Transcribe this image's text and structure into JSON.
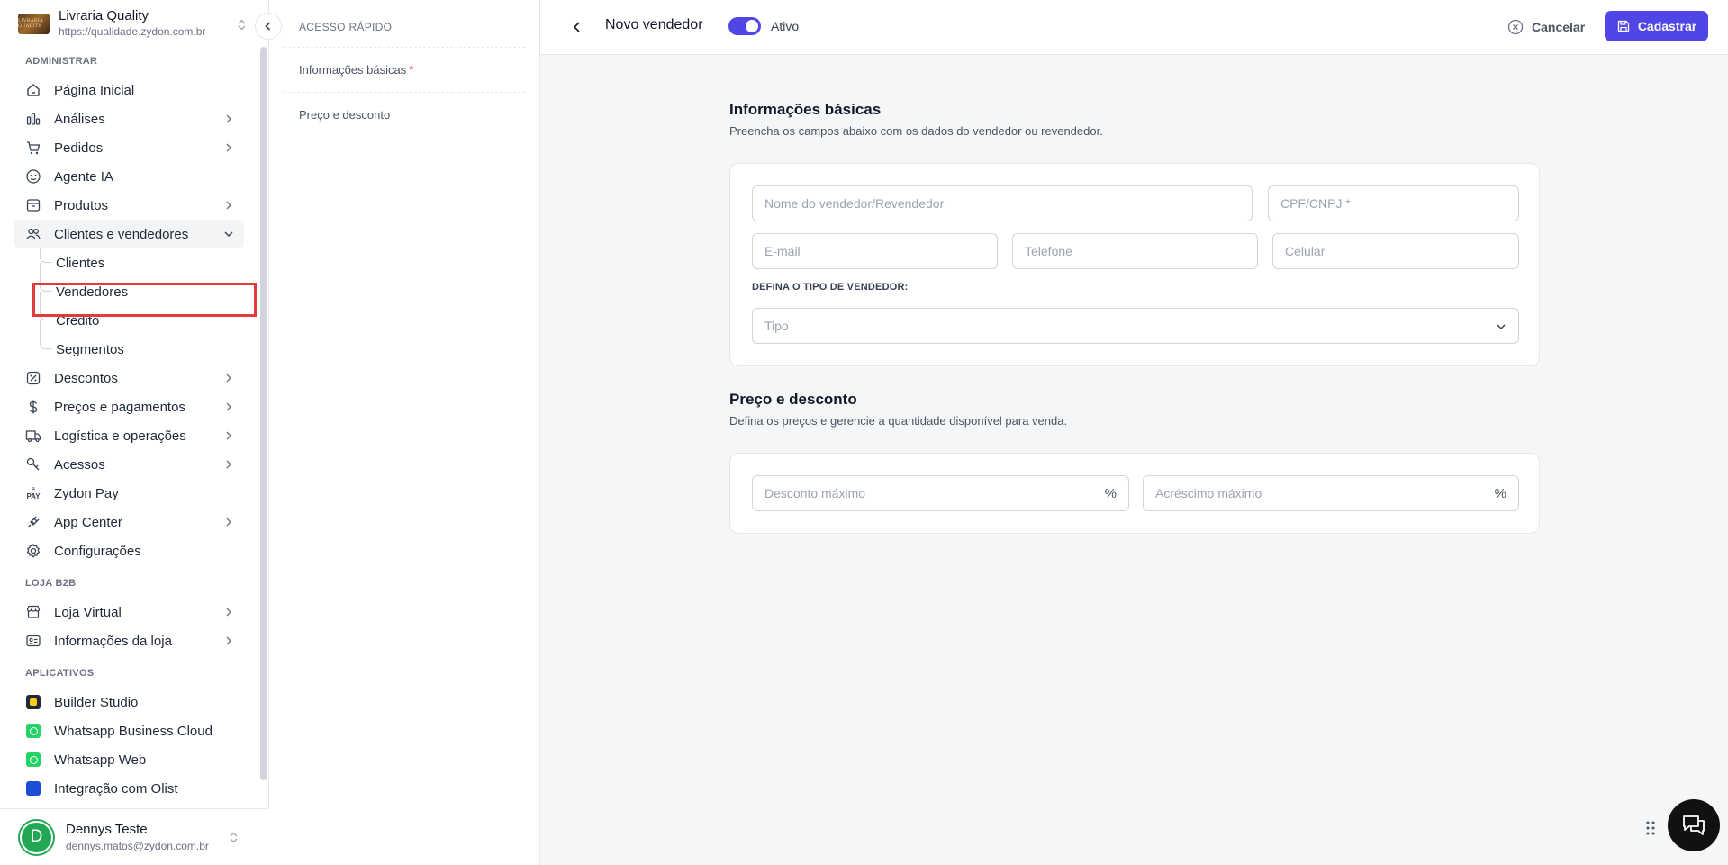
{
  "store": {
    "name": "Livraria Quality",
    "url": "https://qualidade.zydon.com.br",
    "logo_text": "LIVRARIA QUALITY"
  },
  "sidebar": {
    "sections": {
      "admin": "ADMINISTRAR",
      "b2b": "LOJA B2B",
      "apps": "APLICATIVOS"
    },
    "items": [
      {
        "label": "Página Inicial"
      },
      {
        "label": "Análises"
      },
      {
        "label": "Pedidos"
      },
      {
        "label": "Agente IA"
      },
      {
        "label": "Produtos"
      },
      {
        "label": "Clientes e vendedores"
      },
      {
        "label": "Descontos"
      },
      {
        "label": "Preços e pagamentos"
      },
      {
        "label": "Logística e operações"
      },
      {
        "label": "Acessos"
      },
      {
        "label": "Zydon Pay"
      },
      {
        "label": "App Center"
      },
      {
        "label": "Configurações"
      }
    ],
    "sub_items": [
      {
        "label": "Clientes"
      },
      {
        "label": "Vendedores"
      },
      {
        "label": "Crédito"
      },
      {
        "label": "Segmentos"
      }
    ],
    "b2b_items": [
      {
        "label": "Loja Virtual"
      },
      {
        "label": "Informações da loja"
      }
    ],
    "apps": [
      {
        "label": "Builder Studio",
        "color": "#1f2937"
      },
      {
        "label": "Whatsapp Business Cloud",
        "color": "#25d366"
      },
      {
        "label": "Whatsapp Web",
        "color": "#25d366"
      },
      {
        "label": "Integração com Olist",
        "color": "#1d4ed8"
      }
    ],
    "pay_icon_text": "PAY"
  },
  "user": {
    "initial": "D",
    "name": "Dennys Teste",
    "email": "dennys.matos@zydon.com.br"
  },
  "quick_access": {
    "title": "ACESSO RÁPIDO",
    "items": [
      {
        "label": "Informações básicas",
        "required": "*"
      },
      {
        "label": "Preço e desconto"
      }
    ]
  },
  "topbar": {
    "title": "Novo vendedor",
    "active_label": "Ativo",
    "active": true,
    "cancel_label": "Cancelar",
    "submit_label": "Cadastrar",
    "accent": "#4f46e5"
  },
  "basic_info": {
    "title": "Informações básicas",
    "subtitle": "Preencha os campos abaixo com os dados do vendedor ou revendedor.",
    "name_placeholder": "Nome do vendedor/Revendedor",
    "doc_placeholder": "CPF/CNPJ *",
    "email_placeholder": "E-mail",
    "phone_placeholder": "Telefone",
    "mobile_placeholder": "Celular",
    "type_label": "DEFINA O TIPO DE VENDEDOR:",
    "type_placeholder": "Tipo"
  },
  "pricing": {
    "title": "Preço e desconto",
    "subtitle": "Defina os preços e gerencie a quantidade disponível para venda.",
    "max_discount_placeholder": "Desconto máximo",
    "max_increase_placeholder": "Acréscimo máximo",
    "suffix": "%"
  }
}
